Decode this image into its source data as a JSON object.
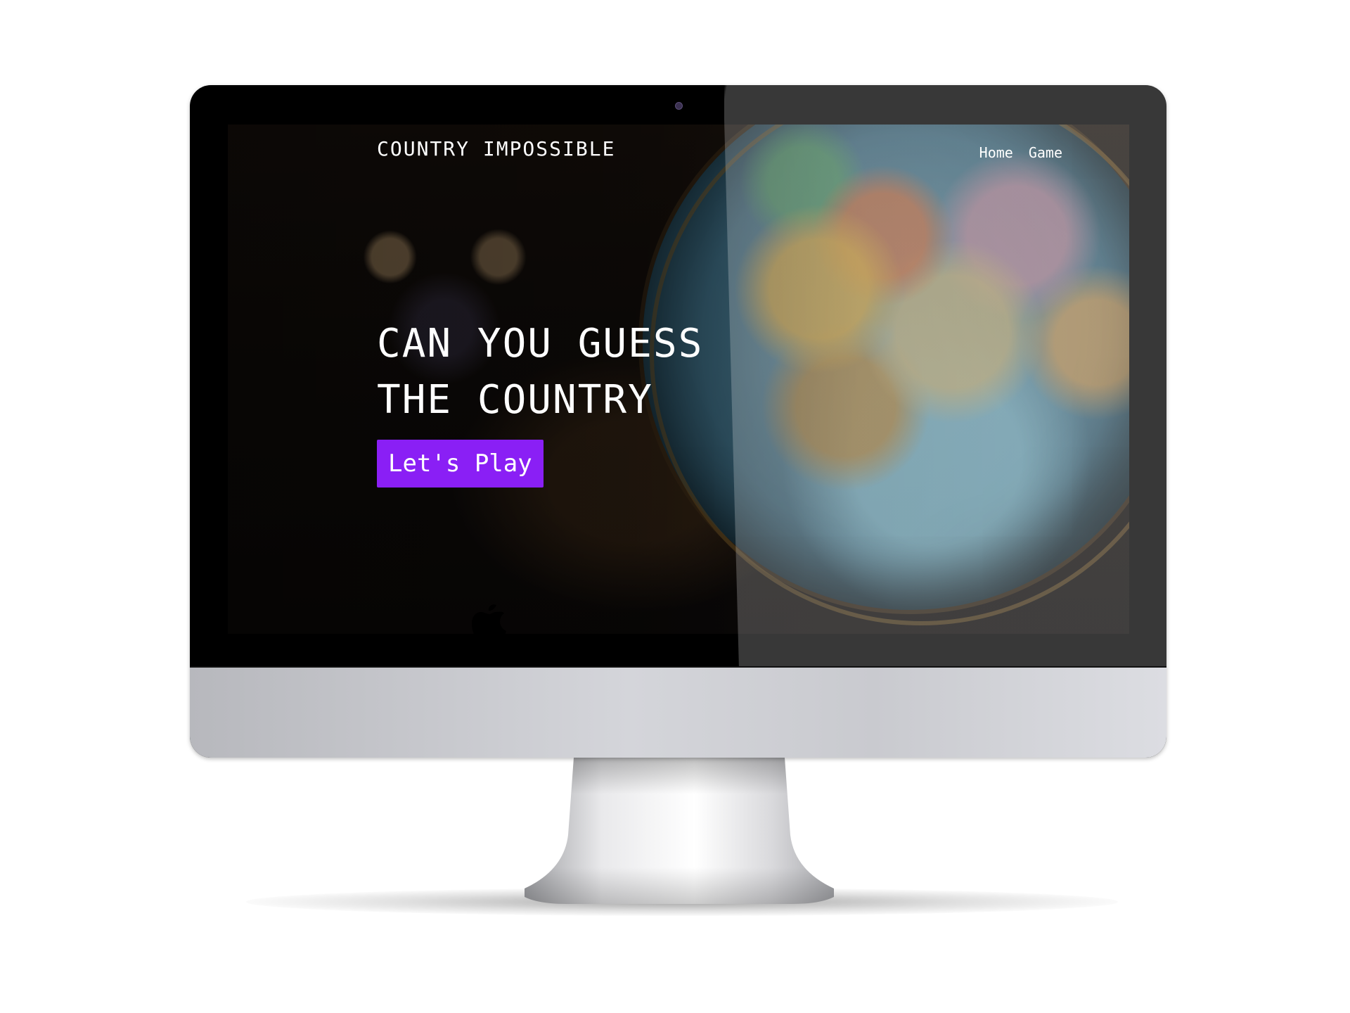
{
  "site": {
    "title": "COUNTRY IMPOSSIBLE",
    "nav": [
      {
        "label": "Home"
      },
      {
        "label": "Game"
      }
    ]
  },
  "hero": {
    "line1": "CAN YOU GUESS",
    "line2": "THE COUNTRY",
    "cta_label": "Let's Play"
  },
  "colors": {
    "accent": "#8a1ff5",
    "text": "#ffffff",
    "bezel": "#000000",
    "chin": "#c9cacf"
  },
  "icons": {
    "brand_logo": "apple-logo-icon",
    "camera": "webcam-icon"
  }
}
